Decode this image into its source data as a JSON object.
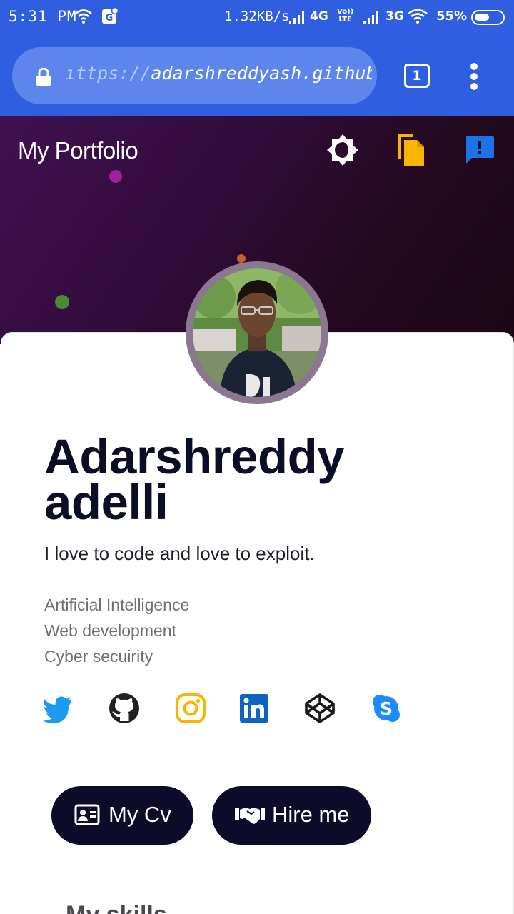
{
  "status_bar": {
    "time": "5:31 PM",
    "network_speed": "1.32KB/s",
    "sim1_type": "4G",
    "volte_top": "Vo))",
    "volte_bottom": "LTE",
    "sim2_type": "3G",
    "battery_percent": "55%",
    "battery_level": 0.55
  },
  "browser": {
    "url_dim": "ıttps://",
    "url_main": "adarshreddyash.github.io",
    "tab_count": "1"
  },
  "header": {
    "title": "My Portfolio",
    "icons": [
      "brightness-icon",
      "copy-icon",
      "feedback-icon"
    ]
  },
  "profile": {
    "name_line1": "Adarshreddy",
    "name_line2": "adelli",
    "tagline": "I love to code and love to exploit.",
    "interests": [
      "Artificial Intelligence",
      "Web development",
      "Cyber secuirity"
    ]
  },
  "social_links": [
    "twitter-icon",
    "github-icon",
    "instagram-icon",
    "linkedin-icon",
    "codepen-icon",
    "skype-icon"
  ],
  "buttons": {
    "cv": "My Cv",
    "hire": "Hire me"
  },
  "section_peek": "My skills",
  "colors": {
    "browser_blue": "#2f5fe0",
    "hero_purple": "#3f1150",
    "button_navy": "#0c0b2a",
    "twitter": "#1d9bf0",
    "instagram": "#f7b500",
    "linkedin": "#0a66c2",
    "skype": "#1a8cff"
  }
}
